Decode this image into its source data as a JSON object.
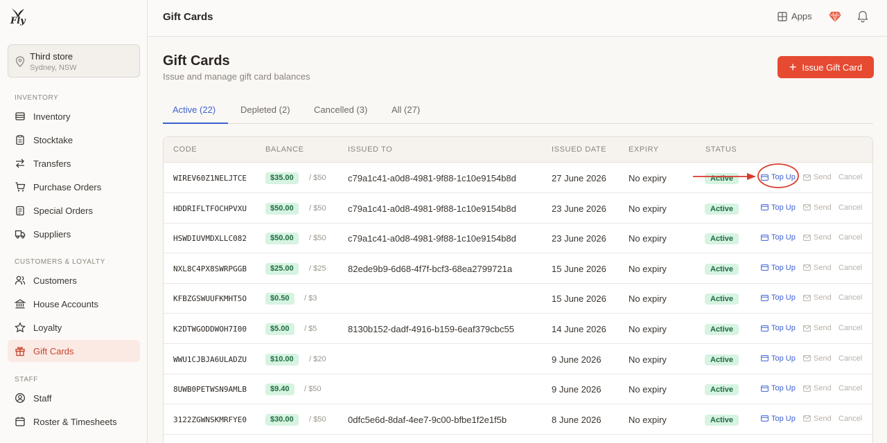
{
  "app": {
    "logo_text": "Fly"
  },
  "store": {
    "name": "Third store",
    "location": "Sydney, NSW"
  },
  "sidebar": {
    "sections": [
      {
        "label": "INVENTORY"
      },
      {
        "label": "CUSTOMERS & LOYALTY"
      },
      {
        "label": "STAFF"
      }
    ],
    "items": [
      {
        "label": "Inventory",
        "icon": "box-icon"
      },
      {
        "label": "Stocktake",
        "icon": "clipboard-icon"
      },
      {
        "label": "Transfers",
        "icon": "transfer-icon"
      },
      {
        "label": "Purchase Orders",
        "icon": "cart-icon"
      },
      {
        "label": "Special Orders",
        "icon": "clipboard-list-icon"
      },
      {
        "label": "Suppliers",
        "icon": "truck-icon"
      },
      {
        "label": "Customers",
        "icon": "users-icon"
      },
      {
        "label": "House Accounts",
        "icon": "bank-icon"
      },
      {
        "label": "Loyalty",
        "icon": "star-icon"
      },
      {
        "label": "Gift Cards",
        "icon": "gift-icon"
      },
      {
        "label": "Staff",
        "icon": "user-circle-icon"
      },
      {
        "label": "Roster & Timesheets",
        "icon": "calendar-icon"
      }
    ]
  },
  "topbar": {
    "title": "Gift Cards",
    "apps_label": "Apps"
  },
  "page": {
    "title": "Gift Cards",
    "subtitle": "Issue and manage gift card balances",
    "issue_button": "Issue Gift Card"
  },
  "tabs": [
    {
      "label": "Active (22)"
    },
    {
      "label": "Depleted (2)"
    },
    {
      "label": "Cancelled (3)"
    },
    {
      "label": "All (27)"
    }
  ],
  "table": {
    "headers": [
      "CODE",
      "BALANCE",
      "ISSUED TO",
      "ISSUED DATE",
      "EXPIRY",
      "STATUS"
    ],
    "actions": {
      "topup": "Top Up",
      "send": "Send",
      "cancel": "Cancel"
    },
    "rows": [
      {
        "code": "WIREV60Z1NELJTCE",
        "balance": "$35.00",
        "of": "/ $50",
        "issued_to": "c79a1c41-a0d8-4981-9f88-1c10e9154b8d",
        "date": "27 June 2026",
        "expiry": "No expiry",
        "status": "Active"
      },
      {
        "code": "HDDRIFLTFOCHPVXU",
        "balance": "$50.00",
        "of": "/ $50",
        "issued_to": "c79a1c41-a0d8-4981-9f88-1c10e9154b8d",
        "date": "23 June 2026",
        "expiry": "No expiry",
        "status": "Active"
      },
      {
        "code": "HSWDIUVMDXLLC082",
        "balance": "$50.00",
        "of": "/ $50",
        "issued_to": "c79a1c41-a0d8-4981-9f88-1c10e9154b8d",
        "date": "23 June 2026",
        "expiry": "No expiry",
        "status": "Active"
      },
      {
        "code": "NXL8C4PX8SWRPGGB",
        "balance": "$25.00",
        "of": "/ $25",
        "issued_to": "82ede9b9-6d68-4f7f-bcf3-68ea2799721a",
        "date": "15 June 2026",
        "expiry": "No expiry",
        "status": "Active"
      },
      {
        "code": "KFBZGSWUUFKMHT5O",
        "balance": "$0.50",
        "of": "/ $3",
        "issued_to": "",
        "date": "15 June 2026",
        "expiry": "No expiry",
        "status": "Active"
      },
      {
        "code": "K2DTWGODDWOH7I00",
        "balance": "$5.00",
        "of": "/ $5",
        "issued_to": "8130b152-dadf-4916-b159-6eaf379cbc55",
        "date": "14 June 2026",
        "expiry": "No expiry",
        "status": "Active"
      },
      {
        "code": "WWU1CJBJA6ULADZU",
        "balance": "$10.00",
        "of": "/ $20",
        "issued_to": "",
        "date": "9 June 2026",
        "expiry": "No expiry",
        "status": "Active"
      },
      {
        "code": "8UWB0PETWSN9AMLB",
        "balance": "$9.40",
        "of": "/ $50",
        "issued_to": "",
        "date": "9 June 2026",
        "expiry": "No expiry",
        "status": "Active"
      },
      {
        "code": "3122ZGWNSKMRFYE0",
        "balance": "$30.00",
        "of": "/ $50",
        "issued_to": "0dfc5e6d-8daf-4ee7-9c00-bfbe1f2e1f5b",
        "date": "8 June 2026",
        "expiry": "No expiry",
        "status": "Active"
      }
    ]
  },
  "colors": {
    "accent": "#e64a31",
    "link": "#3c5fd0",
    "active_badge": "#d7f3e2",
    "annotation": "#d93a2b"
  }
}
